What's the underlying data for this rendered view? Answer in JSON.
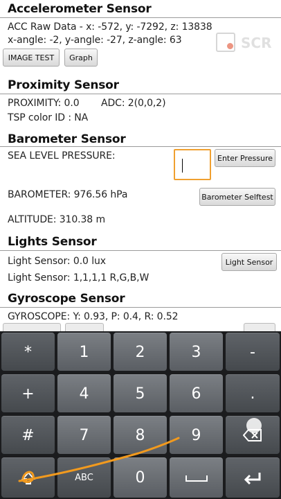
{
  "accelerometer": {
    "title": "Accelerometer Sensor",
    "raw_data": "ACC Raw Data - x: -572, y: -7292, z: 13838",
    "angles": "x-angle: -2, y-angle: -27, z-angle: 63",
    "image_test_label": "IMAGE TEST",
    "graph_label": "Graph"
  },
  "recorder_watermark": "SCR",
  "proximity": {
    "title": "Proximity Sensor",
    "proximity_value": "PROXIMITY: 0.0",
    "adc_value": "ADC: 2(0,0,2)",
    "tsp_color": "TSP color ID : NA"
  },
  "barometer": {
    "title": "Barometer Sensor",
    "sea_level_label": "SEA LEVEL PRESSURE:",
    "pressure_input_value": "",
    "enter_pressure_label": "Enter Pressure",
    "barometer_value": "BAROMETER: 976.56 hPa",
    "selftest_label": "Barometer Selftest",
    "altitude_value": "ALTITUDE: 310.38 m"
  },
  "lights": {
    "title": "Lights Sensor",
    "light_value": "Light Sensor: 0.0 lux",
    "light_rgbw": "Light Sensor: 1,1,1,1 R,G,B,W",
    "light_button_label": "Light Sensor"
  },
  "gyroscope": {
    "title": "Gyroscope Sensor",
    "gyro_value": "GYROSCOPE: Y: 0.93, P: 0.4, R: 0.52"
  },
  "keyboard": {
    "row1": [
      "*",
      "1",
      "2",
      "3",
      "-"
    ],
    "row2": [
      "+",
      "4",
      "5",
      "6",
      "."
    ],
    "row3": [
      "#",
      "7",
      "8",
      "9",
      "backspace"
    ],
    "row4": [
      "shift",
      "ABC",
      "0",
      "space",
      "enter"
    ],
    "abc_label": "ABC"
  },
  "colors": {
    "accent_orange": "#f0a030",
    "keyboard_bg": "#1b1c1e",
    "key_face": "#6b6f74",
    "annotation_stroke": "#f29a1e"
  }
}
